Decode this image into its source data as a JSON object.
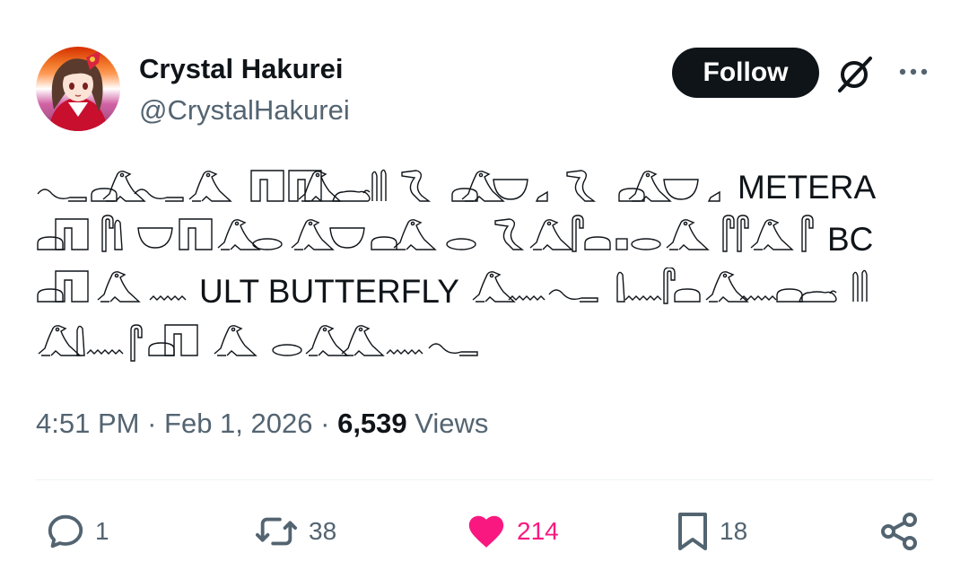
{
  "author": {
    "display_name": "Crystal Hakurei",
    "handle": "@CrystalHakurei"
  },
  "header": {
    "follow_label": "Follow",
    "grok_icon": "grok-icon",
    "more_icon": "more-dots-icon"
  },
  "tweet": {
    "inline_words": [
      "METERA",
      "BC",
      "ULT BUTTERFLY"
    ],
    "glyph_style": "egyptian-hieroglyph-outline"
  },
  "meta": {
    "time": "4:51 PM",
    "separator": "·",
    "date": "Feb 1, 2026",
    "views_count": "6,539",
    "views_label": "Views"
  },
  "actions": {
    "replies": "1",
    "retweets": "38",
    "likes": "214",
    "bookmarks": "18"
  },
  "colors": {
    "text": "#0f1419",
    "secondary": "#536471",
    "like": "#f91880",
    "button": "#0f1419",
    "divider": "#eff3f4"
  }
}
